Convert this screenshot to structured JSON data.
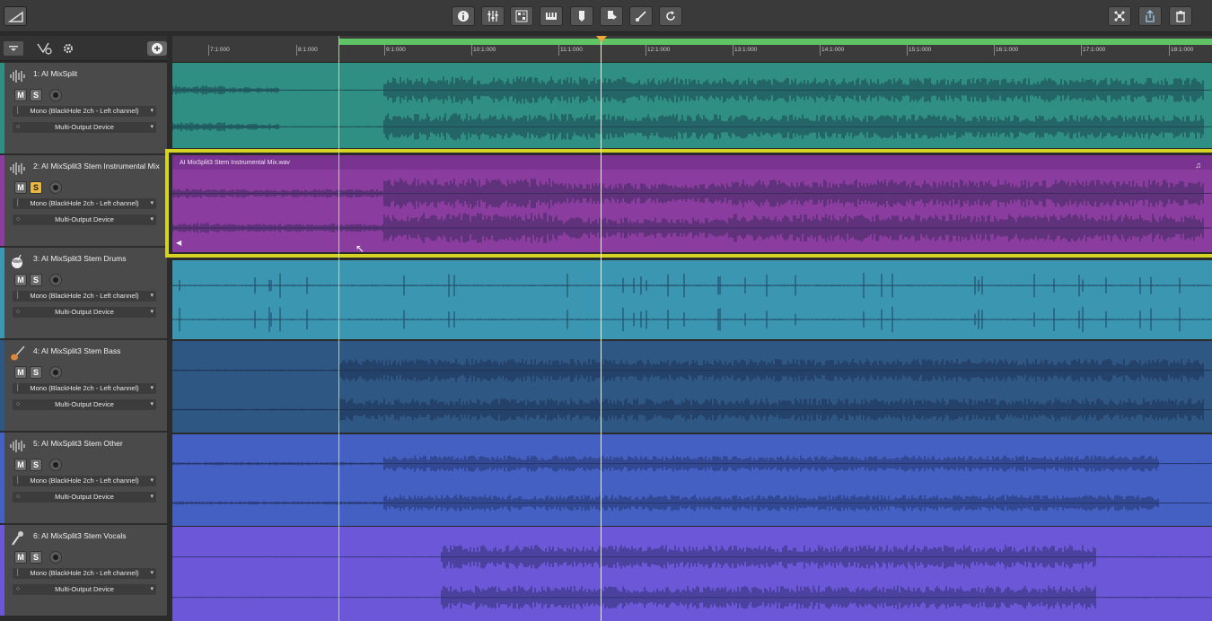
{
  "toolbar": {
    "left_tool": "resize-icon",
    "center_buttons": [
      "info-icon",
      "mixer-icon",
      "grid-icon",
      "piano-icon",
      "export-icon",
      "import-icon",
      "brush-icon",
      "loop-icon"
    ],
    "right_buttons": [
      "network-icon",
      "share-icon",
      "trash-icon"
    ]
  },
  "sidebar": {
    "head_icons": [
      "menu-icon",
      "route-icon",
      "settings-icon",
      "add-track-icon"
    ]
  },
  "ruler": {
    "ticks": [
      "7:1:000",
      "8:1:000",
      "9:1:000",
      "10:1:000",
      "11:1:000",
      "12:1:000",
      "13:1:000",
      "14:1:000",
      "15:1:000",
      "16:1:000",
      "17:1:000",
      "18:1:000"
    ]
  },
  "tracks": [
    {
      "name": "1: AI MixSplit",
      "input": "Mono (BlackHole 2ch - Left channel)",
      "output": "Multi-Output Device",
      "color": "#2f8f82",
      "icon": "waveform-icon",
      "solo": false
    },
    {
      "name": "2: AI MixSplit3 Stem Instrumental Mix",
      "input": "Mono (BlackHole 2ch - Left channel)",
      "output": "Multi-Output Device",
      "color": "#8a3d9f",
      "icon": "waveform-icon",
      "solo": true,
      "clip": "AI MixSplit3 Stem Instrumental Mix.wav"
    },
    {
      "name": "3: AI MixSplit3 Stem Drums",
      "input": "Mono (BlackHole 2ch - Left channel)",
      "output": "Multi-Output Device",
      "color": "#3b97b1",
      "icon": "drum-icon",
      "solo": false
    },
    {
      "name": "4: AI MixSplit3 Stem Bass",
      "input": "Mono (BlackHole 2ch - Left channel)",
      "output": "Multi-Output Device",
      "color": "#2f5783",
      "icon": "guitar-icon",
      "solo": false
    },
    {
      "name": "5: AI MixSplit3 Stem Other",
      "input": "Mono (BlackHole 2ch - Left channel)",
      "output": "Multi-Output Device",
      "color": "#4560c3",
      "icon": "waveform-icon",
      "solo": false
    },
    {
      "name": "6: AI MixSplit3 Stem Vocals",
      "input": "Mono (BlackHole 2ch - Left channel)",
      "output": "Multi-Output Device",
      "color": "#6b57d8",
      "icon": "microphone-icon",
      "solo": false
    }
  ],
  "labels": {
    "mute": "M",
    "solo": "S"
  }
}
